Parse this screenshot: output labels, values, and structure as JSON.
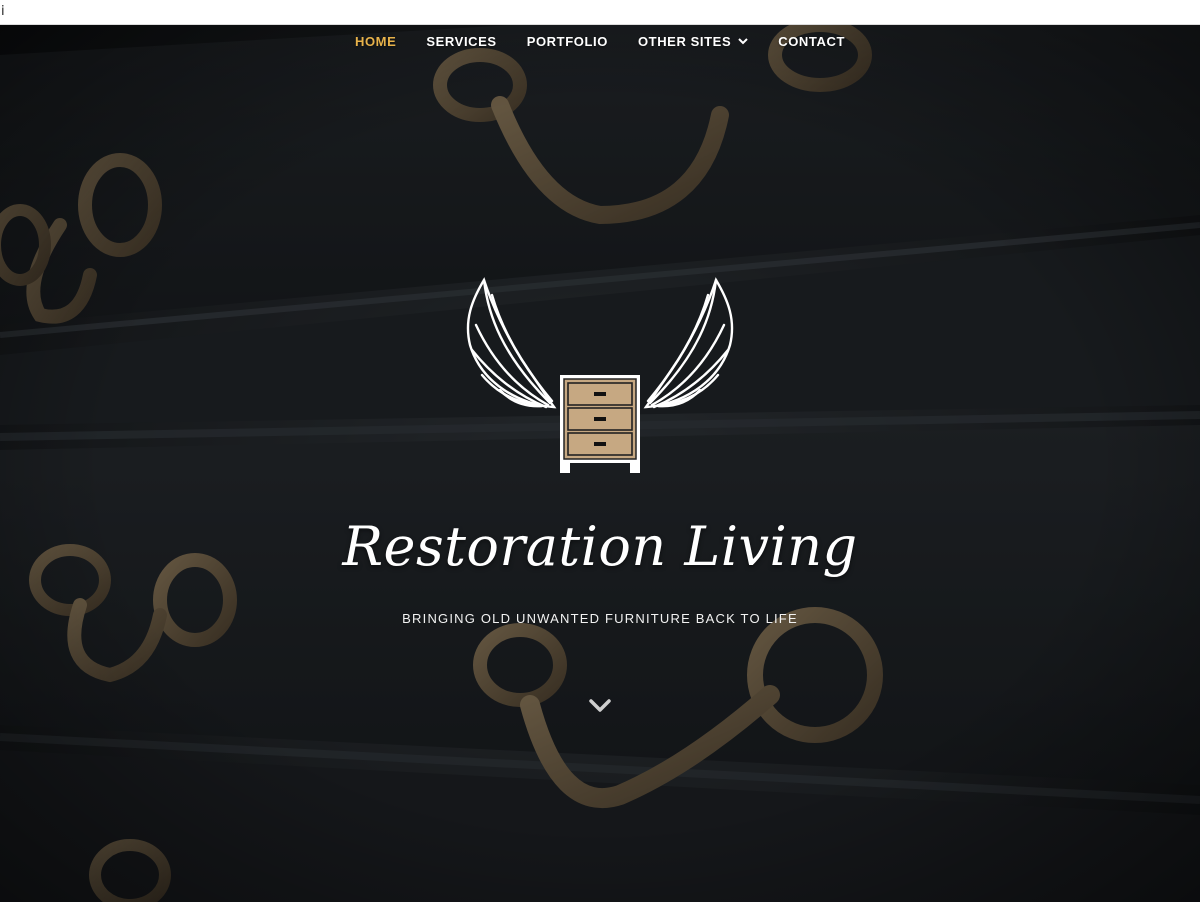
{
  "browser": {
    "cursor_glyph": "i"
  },
  "nav": {
    "items": [
      {
        "label": "HOME"
      },
      {
        "label": "SERVICES"
      },
      {
        "label": "PORTFOLIO"
      },
      {
        "label": "OTHER SITES"
      },
      {
        "label": "CONTACT"
      }
    ],
    "active_color": "#e7b24a",
    "dropdown_icon": "chevron-down-icon"
  },
  "hero": {
    "title": "Restoration Living",
    "subtitle": "BRINGING OLD UNWANTED FURNITURE BACK TO LIFE",
    "logo_icon": "winged-dresser-icon",
    "scroll_icon": "chevron-down-icon",
    "background": "close-up of dark painted dresser drawers with brass handles"
  }
}
